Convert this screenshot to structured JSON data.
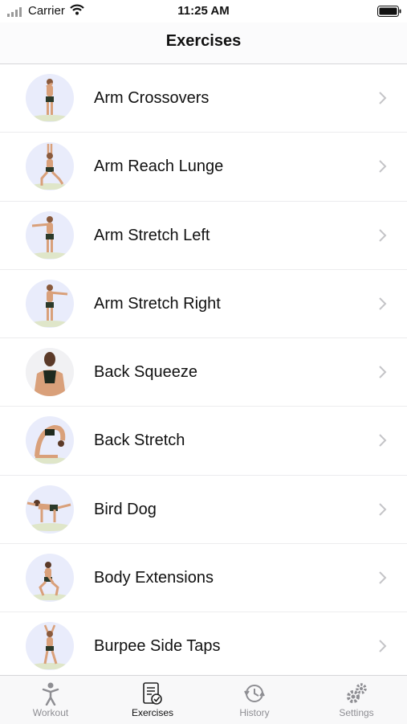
{
  "status_bar": {
    "carrier": "Carrier",
    "time": "11:25 AM"
  },
  "header": {
    "title": "Exercises"
  },
  "exercises": [
    {
      "label": "Arm Crossovers"
    },
    {
      "label": "Arm Reach Lunge"
    },
    {
      "label": "Arm Stretch Left"
    },
    {
      "label": "Arm Stretch Right"
    },
    {
      "label": "Back Squeeze"
    },
    {
      "label": "Back Stretch"
    },
    {
      "label": "Bird Dog"
    },
    {
      "label": "Body Extensions"
    },
    {
      "label": "Burpee Side Taps"
    }
  ],
  "tabs": [
    {
      "label": "Workout",
      "icon": "person-icon",
      "active": false
    },
    {
      "label": "Exercises",
      "icon": "checklist-icon",
      "active": true
    },
    {
      "label": "History",
      "icon": "history-icon",
      "active": false
    },
    {
      "label": "Settings",
      "icon": "gears-icon",
      "active": false
    }
  ],
  "colors": {
    "accent": "#111111",
    "inactive": "#8e8e93",
    "thumb_bg": "#e9ecfb"
  }
}
